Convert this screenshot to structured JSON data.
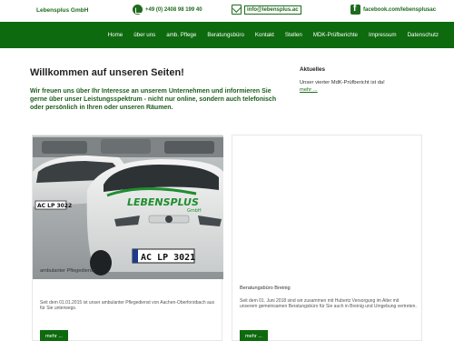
{
  "header": {
    "brand": "Lebensplus GmbH",
    "phone": "+49 (0) 2408 98 199 40",
    "email": "info@lebensplus.ac",
    "facebook": "facebook.com/lebensplusac"
  },
  "nav": {
    "items": [
      "Home",
      "über uns",
      "amb. Pflege",
      "Beratungsbüro",
      "Kontakt",
      "Stellen",
      "MDK-Prüfberichte",
      "Impressum",
      "Datenschutz"
    ]
  },
  "main": {
    "title": "Willkommen auf unseren Seiten!",
    "intro": "Wir freuen uns über Ihr Interesse an unserem Unternehmen und informieren Sie gerne über unser Leistungsspektrum - nicht nur online, sondern auch telefonisch oder persönlich in Ihren oder unseren Räumen."
  },
  "news": {
    "title": "Aktuelles",
    "text": "Unser vierter MdK-Prüfbericht ist da!",
    "more": "mehr ..."
  },
  "cards": [
    {
      "title": "ambulanter Pflegedienst",
      "text": "Seit dem 01.01.2015 ist unser ambulanter Pflegedienst von Aachen-Oberforstbach aus für Sie unterwegs.",
      "button": "mehr ...",
      "photo": {
        "logo_text": "LEBENSPLUS",
        "logo_sub": "GmbH",
        "plate_front": "AC LP 3021",
        "plate_back": "AC LP 3022"
      }
    },
    {
      "title": "Beratungsbüro Breinig",
      "text": "Seit dem 01. Juni 2018 sind wir zusammen mit Hubertz Versorgung im Alter mit unserem gemeinsamen Beratungsbüro für Sie auch in Breinig und Umgebung vertreten.",
      "button": "mehr ..."
    }
  ],
  "colors": {
    "brand_green": "#0e6a0e",
    "text_green": "#1e6b1e"
  }
}
